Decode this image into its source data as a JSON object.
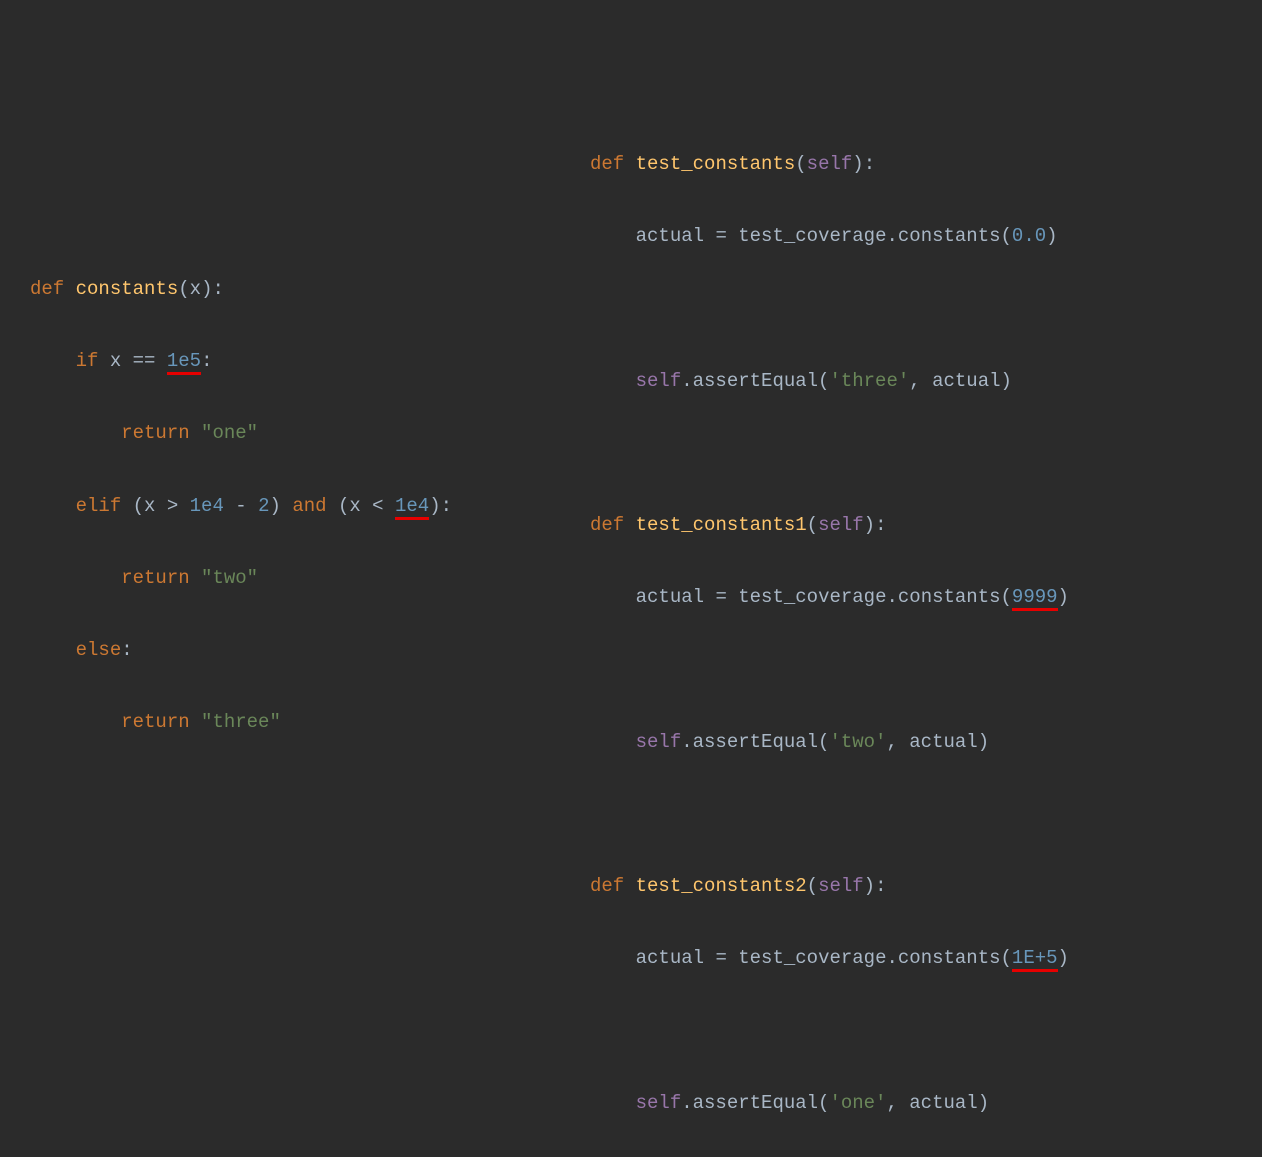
{
  "colors": {
    "bg": "#2b2b2b",
    "keyword": "#cc7832",
    "function": "#ffc66d",
    "self": "#9876aa",
    "number": "#6897bb",
    "string": "#6a8759",
    "default": "#a9b7c6",
    "underline": "#e60000"
  },
  "left": {
    "def": "def",
    "func_name": "constants",
    "param_x": "x",
    "if_kw": "if",
    "x1": "x",
    "eqeq": "==",
    "num_1e5": "1e5",
    "return1": "return",
    "str_one": "\"one\"",
    "elif_kw": "elif",
    "x2": "x",
    "gt": ">",
    "num_1e4a": "1e4",
    "minus": "-",
    "num_2": "2",
    "and_kw": "and",
    "x3": "x",
    "lt": "<",
    "num_1e4b": "1e4",
    "return2": "return",
    "str_two": "\"two\"",
    "else_kw": "else",
    "return3": "return",
    "str_three": "\"three\""
  },
  "right": {
    "def1": "def",
    "fn1": "test_constants",
    "self1": "self",
    "actual1": "actual",
    "eq1": "=",
    "mod1": "test_coverage",
    "call1": "constants",
    "arg1": "0.0",
    "self1b": "self",
    "assert1": "assertEqual",
    "exp1": "'three'",
    "act1": "actual",
    "def2": "def",
    "fn2": "test_constants1",
    "self2": "self",
    "actual2": "actual",
    "eq2": "=",
    "mod2": "test_coverage",
    "call2": "constants",
    "arg2": "9999",
    "self2b": "self",
    "assert2": "assertEqual",
    "exp2": "'two'",
    "act2": "actual",
    "def3": "def",
    "fn3": "test_constants2",
    "self3": "self",
    "actual3": "actual",
    "eq3": "=",
    "mod3": "test_coverage",
    "call3": "constants",
    "arg3": "1E+5",
    "self3b": "self",
    "assert3": "assertEqual",
    "exp3": "'one'",
    "act3": "actual"
  }
}
